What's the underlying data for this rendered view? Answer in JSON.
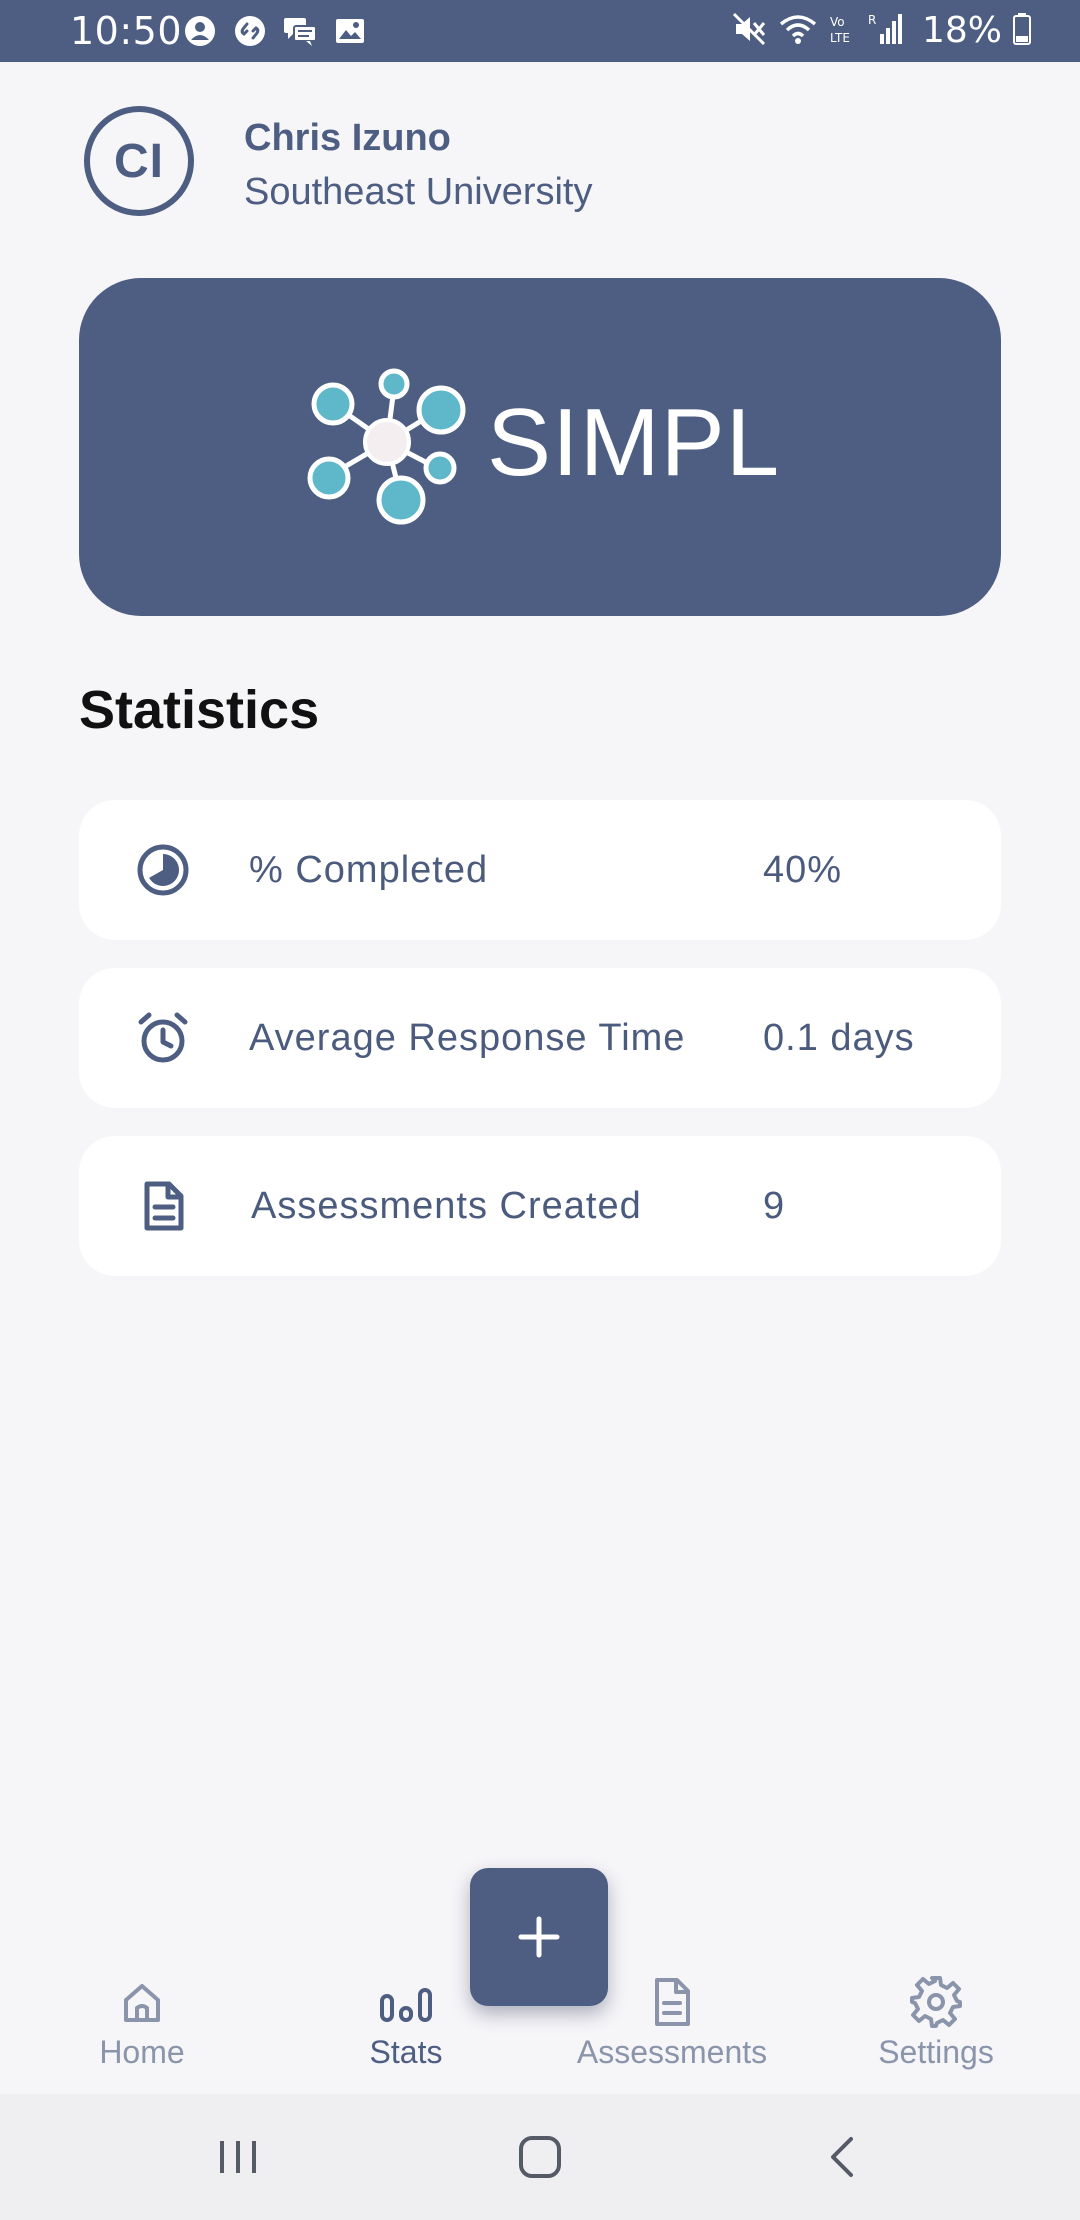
{
  "status_bar": {
    "time": "10:50",
    "battery": "18%",
    "icons_left": [
      "profile-icon",
      "shazam-icon",
      "messages-icon",
      "gallery-icon"
    ],
    "icons_right": [
      "mute-icon",
      "wifi-icon",
      "volte-icon",
      "signal-icon",
      "battery-icon"
    ]
  },
  "profile": {
    "initials": "CI",
    "name": "Chris Izuno",
    "organization": "Southeast University"
  },
  "brand": {
    "name": "SIMPL",
    "color": "#4d5e82",
    "logo_accent": "#5fb8c9"
  },
  "statistics": {
    "title": "Statistics",
    "items": [
      {
        "icon": "pie-chart-icon",
        "label": "% Completed",
        "value": "40%"
      },
      {
        "icon": "alarm-clock-icon",
        "label": "Average Response Time",
        "value": "0.1 days"
      },
      {
        "icon": "document-icon",
        "label": "Assessments Created",
        "value": "9"
      }
    ]
  },
  "fab": {
    "icon": "plus-icon"
  },
  "bottom_nav": {
    "active": "Stats",
    "items": [
      {
        "icon": "home-icon",
        "label": "Home"
      },
      {
        "icon": "bar-chart-icon",
        "label": "Stats"
      },
      {
        "icon": "document-icon",
        "label": "Assessments"
      },
      {
        "icon": "gear-icon",
        "label": "Settings"
      }
    ]
  },
  "system_nav": [
    "recents-button",
    "home-button",
    "back-button"
  ]
}
